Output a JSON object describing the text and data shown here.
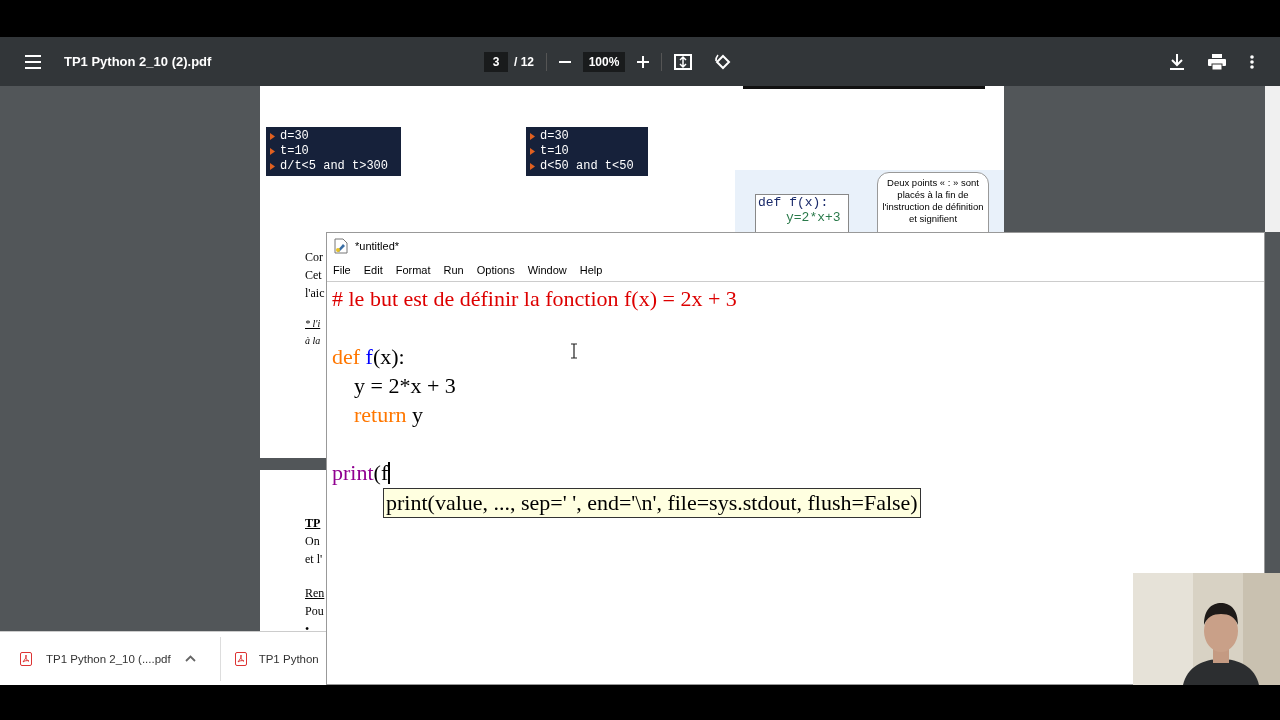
{
  "viewer": {
    "title": "TP1 Python 2_10 (2).pdf",
    "page": "3",
    "page_total": "/ 12",
    "zoom": "100%"
  },
  "pages": [
    {
      "code_boxes": [
        [
          "d=30",
          "t=10",
          "d/t<5 and t>300"
        ],
        [
          "d=30",
          "t=10",
          "d<50 and t<50"
        ]
      ],
      "figure": {
        "code": [
          "def f(x):",
          "y=2*x+3"
        ],
        "callout": "Deux points « : » sont placés à la fin de l'instruction de définition et signifient"
      },
      "text_lines": [
        {
          "text": "Cor",
          "kind": "plain"
        },
        {
          "text": "Cet",
          "kind": "plain"
        },
        {
          "text": "l'aic",
          "kind": "plain"
        },
        {
          "text": "* l'i",
          "kind": "note"
        },
        {
          "text": "à la",
          "kind": "note"
        }
      ]
    },
    {
      "text_lines": [
        {
          "text": "TP",
          "kind": "title"
        },
        {
          "text": "On",
          "kind": "plain"
        },
        {
          "text": "et l'",
          "kind": "plain"
        },
        {
          "text": "Ren",
          "kind": "underlined"
        },
        {
          "text": "Pou",
          "kind": "plain"
        },
        {
          "text": "•",
          "kind": "plain"
        }
      ]
    }
  ],
  "editor": {
    "title": "*untitled*",
    "menu": [
      "File",
      "Edit",
      "Format",
      "Run",
      "Options",
      "Window",
      "Help"
    ],
    "blocks": [
      [
        [
          {
            "kind": "comment",
            "text": "# le but est de définir la fonction f(x) = 2x + 3"
          }
        ]
      ],
      [
        [
          {
            "kind": "keyword",
            "text": "def "
          },
          {
            "kind": "definition",
            "text": "f"
          },
          {
            "kind": "plain",
            "text": "(x):"
          }
        ],
        [
          {
            "kind": "plain",
            "text": "    y = 2*x + 3"
          }
        ],
        [
          {
            "kind": "keyword",
            "text": "    return"
          },
          {
            "kind": "plain",
            "text": " y"
          }
        ]
      ],
      [
        [
          {
            "kind": "builtin",
            "text": "print"
          },
          {
            "kind": "plain",
            "text": "(f"
          }
        ]
      ]
    ],
    "calltip": "print(value, ..., sep=' ', end='\\n', file=sys.stdout, flush=False)"
  },
  "downloads": [
    {
      "name": "TP1 Python 2_10 (....pdf",
      "menu": true
    },
    {
      "name": "TP1 Python",
      "menu": false
    }
  ]
}
